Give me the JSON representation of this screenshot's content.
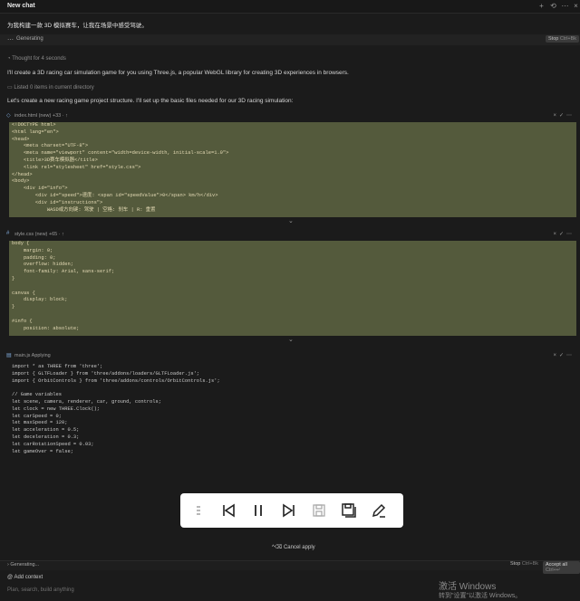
{
  "header": {
    "title": "New chat"
  },
  "messages": {
    "prompt": "为我构建一款 3D 模拟赛车，让我在场景中感受驾驶。",
    "generating_label": "Generating",
    "thought": "Thought for 4 seconds",
    "intro": "I'll create a 3D racing car simulation game for you using Three.js, a popular WebGL library for creating 3D experiences in browsers.",
    "listed": "Listed 0 items in current directory",
    "create_text": "Let's create a new racing game project structure. I'll set up the basic files needed for our 3D racing simulation:"
  },
  "stop_button": {
    "label": "Stop",
    "shortcut": "Ctrl+Bk"
  },
  "files": [
    {
      "name": "index.html (new) +33 · ↑",
      "lines": [
        "<!DOCTYPE html>",
        "<html lang=\"en\">",
        "<head>",
        "    <meta charset=\"UTF-8\">",
        "    <meta name=\"viewport\" content=\"width=device-width, initial-scale=1.0\">",
        "    <title>3D赛车模拟器</title>",
        "    <link rel=\"stylesheet\" href=\"style.css\">",
        "</head>",
        "<body>",
        "    <div id=\"info\">",
        "        <div id=\"speed\">速度: <span id=\"speedValue\">0</span> km/h</div>",
        "        <div id=\"instructions\">",
        "            WASD或方向键: 驾驶 | 空格: 刹车 | R: 重置"
      ]
    },
    {
      "name": "style.css (new) +65 · ↑",
      "lines": [
        "body {",
        "    margin: 0;",
        "    padding: 0;",
        "    overflow: hidden;",
        "    font-family: Arial, sans-serif;",
        "}",
        "",
        "canvas {",
        "    display: block;",
        "}",
        "",
        "#info {",
        "    position: absolute;"
      ]
    },
    {
      "name": "main.js Applying",
      "lines": [
        "import * as THREE from 'three';",
        "import { GLTFLoader } from 'three/addons/loaders/GLTFLoader.js';",
        "import { OrbitControls } from 'three/addons/controls/OrbitControls.js';",
        "",
        "// Game variables",
        "let scene, camera, renderer, car, ground, controls;",
        "let clock = new THREE.Clock();",
        "let carSpeed = 0;",
        "let maxSpeed = 120;",
        "let acceleration = 0.5;",
        "let deceleration = 0.3;",
        "let carRotationSpeed = 0.03;",
        "let gameOver = false;"
      ]
    }
  ],
  "player": {
    "buttons": [
      "drag-handle-icon",
      "skip-back-icon",
      "pause-icon",
      "skip-forward-icon",
      "save-icon",
      "save-all-icon",
      "edit-icon"
    ]
  },
  "footer": {
    "cancel_apply": "^⌫ Cancel apply",
    "generating": "Generating...",
    "stop": "Stop",
    "stop_shortcut": "Ctrl+Bk",
    "accept_all": "Accept all",
    "accept_shortcut": "Ctrl+↵",
    "add_context": "Add context",
    "input_placeholder": "Plan, search, build anything"
  },
  "watermark": {
    "line1": "激活 Windows",
    "line2": "转到\"设置\"以激活 Windows。"
  },
  "colors": {
    "highlight": "#545a3c",
    "background": "#1b1b1b"
  }
}
